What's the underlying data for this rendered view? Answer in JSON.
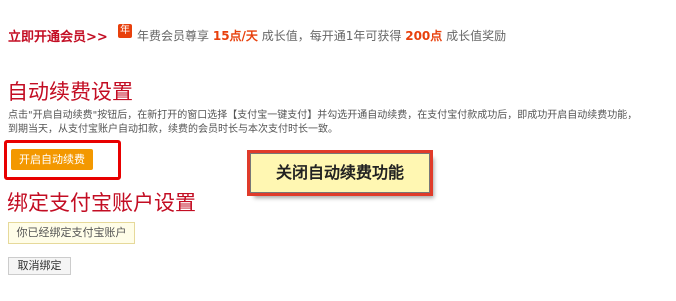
{
  "banner": {
    "open_vip_label": "立即开通会员>>",
    "year_badge": "年",
    "promo_prefix": "年费会员尊享",
    "promo_rate": "15点/天",
    "promo_mid": "成长值，每开通1年可获得",
    "promo_points": "200点",
    "promo_suffix": "成长值奖励"
  },
  "auto_renew": {
    "title": "自动续费设置",
    "desc_line1": "点击\"开启自动续费\"按钮后，在新打开的窗口选择【支付宝一键支付】并勾选开通自动续费，在支付宝付款成功后，即成功开启自动续费功能，",
    "desc_line2": "到期当天，从支付宝账户自动扣款，续费的会员时长与本次支付时长一致。",
    "enable_button": "开启自动续费"
  },
  "annotation": {
    "text": "关闭自动续费功能"
  },
  "alipay": {
    "title": "绑定支付宝账户设置",
    "bound_text": "你已经绑定支付宝账户",
    "unbind_button": "取消绑定"
  },
  "colors": {
    "title_red": "#c30d23",
    "highlight_orange": "#e8400c",
    "button_orange": "#f39800"
  }
}
